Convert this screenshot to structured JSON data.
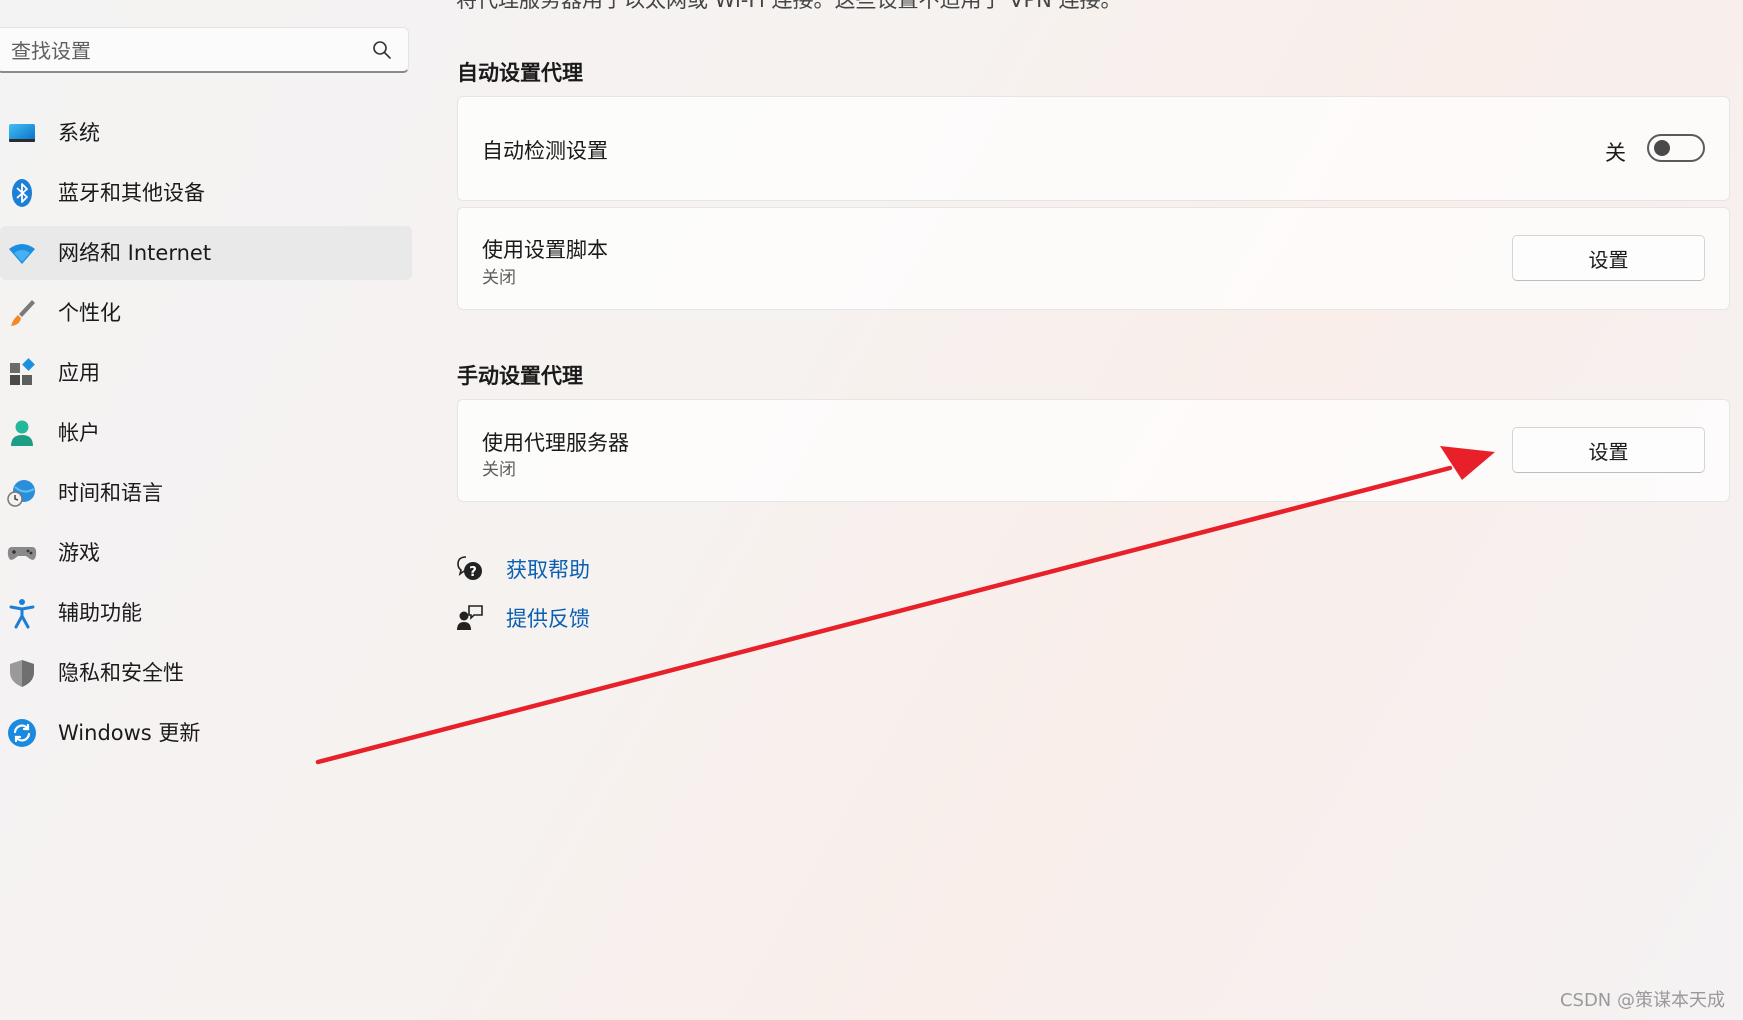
{
  "search": {
    "placeholder": "查找设置"
  },
  "sidebar": {
    "items": [
      {
        "label": "系统",
        "icon": "system-monitor-icon"
      },
      {
        "label": "蓝牙和其他设备",
        "icon": "bluetooth-icon"
      },
      {
        "label": "网络和 Internet",
        "icon": "wifi-icon",
        "selected": true
      },
      {
        "label": "个性化",
        "icon": "paintbrush-icon"
      },
      {
        "label": "应用",
        "icon": "apps-icon"
      },
      {
        "label": "帐户",
        "icon": "account-icon"
      },
      {
        "label": "时间和语言",
        "icon": "globe-clock-icon"
      },
      {
        "label": "游戏",
        "icon": "gamepad-icon"
      },
      {
        "label": "辅助功能",
        "icon": "accessibility-icon"
      },
      {
        "label": "隐私和安全性",
        "icon": "shield-icon"
      },
      {
        "label": "Windows 更新",
        "icon": "update-icon"
      }
    ]
  },
  "main": {
    "cut_text": "将代理服务器用于以太网或 Wi-Fi 连接。这些设置不适用于 VPN 连接。",
    "auto_section": {
      "title": "自动设置代理",
      "detect": {
        "label": "自动检测设置",
        "state_label": "关",
        "on": false
      },
      "script": {
        "label": "使用设置脚本",
        "status": "关闭",
        "button": "设置"
      }
    },
    "manual_section": {
      "title": "手动设置代理",
      "proxy": {
        "label": "使用代理服务器",
        "status": "关闭",
        "button": "设置"
      }
    },
    "links": {
      "help": "获取帮助",
      "feedback": "提供反馈"
    }
  },
  "annotation": {
    "arrow_color": "#e8202a"
  },
  "watermark": "CSDN @策谋本天成",
  "colors": {
    "accent": "#0a5fb4",
    "selected_bg": "#e9e9e9"
  }
}
